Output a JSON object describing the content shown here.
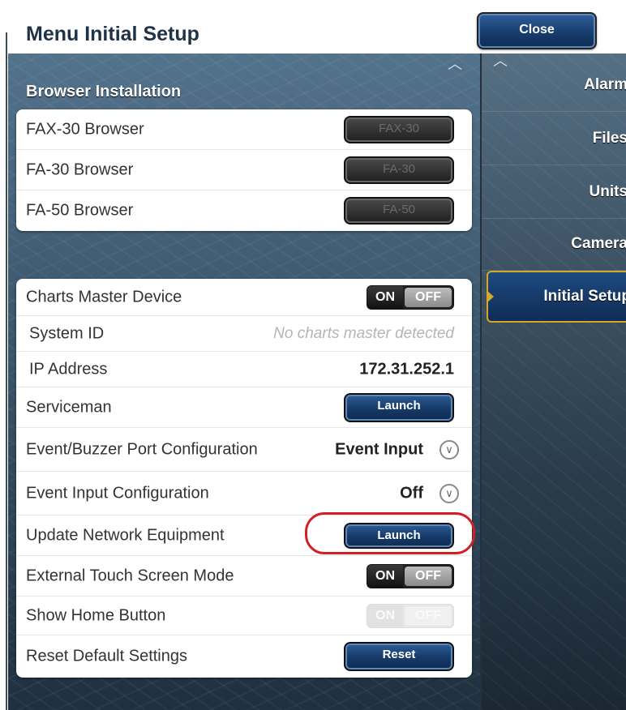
{
  "header": {
    "title": "Menu Initial Setup",
    "close_label": "Close"
  },
  "browser_section": {
    "title": "Browser Installation",
    "items": [
      {
        "label": "FAX-30 Browser",
        "button": "FAX-30"
      },
      {
        "label": "FA-30 Browser",
        "button": "FA-30"
      },
      {
        "label": "FA-50 Browser",
        "button": "FA-50"
      }
    ]
  },
  "settings": {
    "charts_master": {
      "label": "Charts Master Device",
      "on": "ON",
      "off": "OFF"
    },
    "system_id": {
      "label": "System ID",
      "value": "No charts master detected"
    },
    "ip_address": {
      "label": "IP Address",
      "value": "172.31.252.1"
    },
    "serviceman": {
      "label": "Serviceman",
      "button": "Launch"
    },
    "event_buzzer": {
      "label": "Event/Buzzer Port Configuration",
      "value": "Event Input"
    },
    "event_input": {
      "label": "Event Input Configuration",
      "value": "Off"
    },
    "update_network": {
      "label": "Update Network Equipment",
      "button": "Launch"
    },
    "touch_screen": {
      "label": "External Touch Screen Mode",
      "on": "ON",
      "off": "OFF"
    },
    "home_button": {
      "label": "Show Home Button",
      "on": "ON",
      "off": "OFF"
    },
    "reset": {
      "label": "Reset Default Settings",
      "button": "Reset"
    }
  },
  "sidebar": {
    "items": [
      {
        "label": "Alarm"
      },
      {
        "label": "Files"
      },
      {
        "label": "Units"
      },
      {
        "label": "Camera"
      },
      {
        "label": "Initial Setup"
      }
    ]
  }
}
